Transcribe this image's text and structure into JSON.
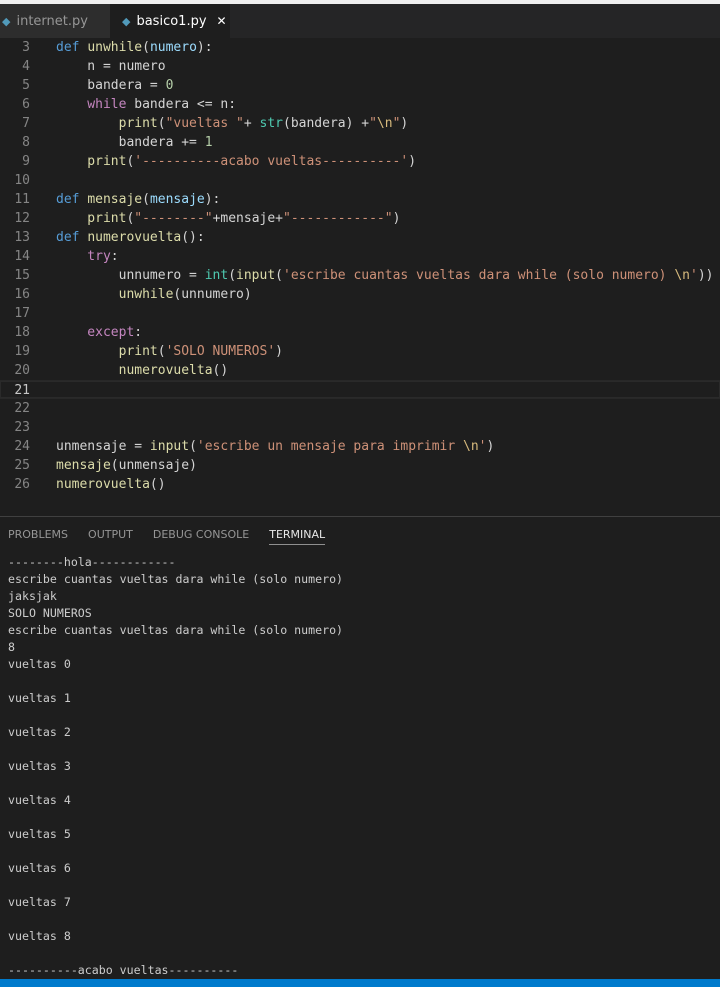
{
  "tabs": [
    {
      "label": "internet.py",
      "icon": "python-icon"
    },
    {
      "label": "basico1.py",
      "icon": "python-icon",
      "close": "✕"
    }
  ],
  "code": [
    {
      "n": "3",
      "t": [
        [
          "kw",
          "def "
        ],
        [
          "fn",
          "unwhile"
        ],
        [
          "",
          "("
        ],
        [
          "pa",
          "numero"
        ],
        [
          "",
          "):"
        ]
      ]
    },
    {
      "n": "4",
      "t": [
        [
          "",
          "    n = numero"
        ]
      ]
    },
    {
      "n": "5",
      "t": [
        [
          "",
          "    bandera = "
        ],
        [
          "nu",
          "0"
        ]
      ]
    },
    {
      "n": "6",
      "t": [
        [
          "ct",
          "    while"
        ],
        [
          "",
          " bandera <= n:"
        ]
      ]
    },
    {
      "n": "7",
      "t": [
        [
          "fn",
          "        print"
        ],
        [
          "",
          "("
        ],
        [
          "st",
          "\"vueltas \""
        ],
        [
          "",
          "+ "
        ],
        [
          "bi",
          "str"
        ],
        [
          "",
          "(bandera) +"
        ],
        [
          "st",
          "\""
        ],
        [
          "es",
          "\\n"
        ],
        [
          "st",
          "\""
        ],
        [
          "",
          ")"
        ]
      ]
    },
    {
      "n": "8",
      "t": [
        [
          "",
          "        bandera += "
        ],
        [
          "nu",
          "1"
        ]
      ]
    },
    {
      "n": "9",
      "t": [
        [
          "fn",
          "    print"
        ],
        [
          "",
          "("
        ],
        [
          "st",
          "'----------acabo vueltas----------'"
        ],
        [
          "",
          ")"
        ]
      ]
    },
    {
      "n": "10",
      "t": []
    },
    {
      "n": "11",
      "t": [
        [
          "kw",
          "def "
        ],
        [
          "fn",
          "mensaje"
        ],
        [
          "",
          "("
        ],
        [
          "pa",
          "mensaje"
        ],
        [
          "",
          "):"
        ]
      ]
    },
    {
      "n": "12",
      "t": [
        [
          "fn",
          "    print"
        ],
        [
          "",
          "("
        ],
        [
          "st",
          "\"--------\""
        ],
        [
          "",
          "+mensaje+"
        ],
        [
          "st",
          "\"------------\""
        ],
        [
          "",
          ")"
        ]
      ]
    },
    {
      "n": "13",
      "t": [
        [
          "kw",
          "def "
        ],
        [
          "fn",
          "numerovuelta"
        ],
        [
          "",
          "():"
        ]
      ]
    },
    {
      "n": "14",
      "t": [
        [
          "ct",
          "    try"
        ],
        [
          "",
          ":"
        ]
      ]
    },
    {
      "n": "15",
      "t": [
        [
          "",
          "        unnumero = "
        ],
        [
          "bi",
          "int"
        ],
        [
          "",
          "("
        ],
        [
          "fn",
          "input"
        ],
        [
          "",
          "("
        ],
        [
          "st",
          "'escribe cuantas vueltas dara while (solo numero) "
        ],
        [
          "es",
          "\\n"
        ],
        [
          "st",
          "'"
        ],
        [
          "",
          "))"
        ]
      ]
    },
    {
      "n": "16",
      "t": [
        [
          "fn",
          "        unwhile"
        ],
        [
          "",
          "(unnumero)"
        ]
      ]
    },
    {
      "n": "17",
      "t": []
    },
    {
      "n": "18",
      "t": [
        [
          "ct",
          "    except"
        ],
        [
          "",
          ":"
        ]
      ]
    },
    {
      "n": "19",
      "t": [
        [
          "fn",
          "        print"
        ],
        [
          "",
          "("
        ],
        [
          "st",
          "'SOLO NUMEROS'"
        ],
        [
          "",
          ")"
        ]
      ]
    },
    {
      "n": "20",
      "t": [
        [
          "fn",
          "        numerovuelta"
        ],
        [
          "",
          "()"
        ]
      ]
    },
    {
      "n": "21",
      "t": [],
      "current": true
    },
    {
      "n": "22",
      "t": []
    },
    {
      "n": "23",
      "t": []
    },
    {
      "n": "24",
      "t": [
        [
          "",
          "unmensaje = "
        ],
        [
          "fn",
          "input"
        ],
        [
          "",
          "("
        ],
        [
          "st",
          "'escribe un mensaje para imprimir "
        ],
        [
          "es",
          "\\n"
        ],
        [
          "st",
          "'"
        ],
        [
          "",
          ")"
        ]
      ]
    },
    {
      "n": "25",
      "t": [
        [
          "fn",
          "mensaje"
        ],
        [
          "",
          "(unmensaje)"
        ]
      ]
    },
    {
      "n": "26",
      "t": [
        [
          "fn",
          "numerovuelta"
        ],
        [
          "",
          "()"
        ]
      ]
    }
  ],
  "panel": {
    "tabs": [
      "PROBLEMS",
      "OUTPUT",
      "DEBUG CONSOLE",
      "TERMINAL"
    ],
    "active": 3
  },
  "terminal": [
    "--------hola------------",
    "escribe cuantas vueltas dara while (solo numero)",
    "jaksjak",
    "SOLO NUMEROS",
    "escribe cuantas vueltas dara while (solo numero)",
    "8",
    "vueltas 0",
    "",
    "vueltas 1",
    "",
    "vueltas 2",
    "",
    "vueltas 3",
    "",
    "vueltas 4",
    "",
    "vueltas 5",
    "",
    "vueltas 6",
    "",
    "vueltas 7",
    "",
    "vueltas 8",
    "",
    "----------acabo vueltas----------"
  ]
}
